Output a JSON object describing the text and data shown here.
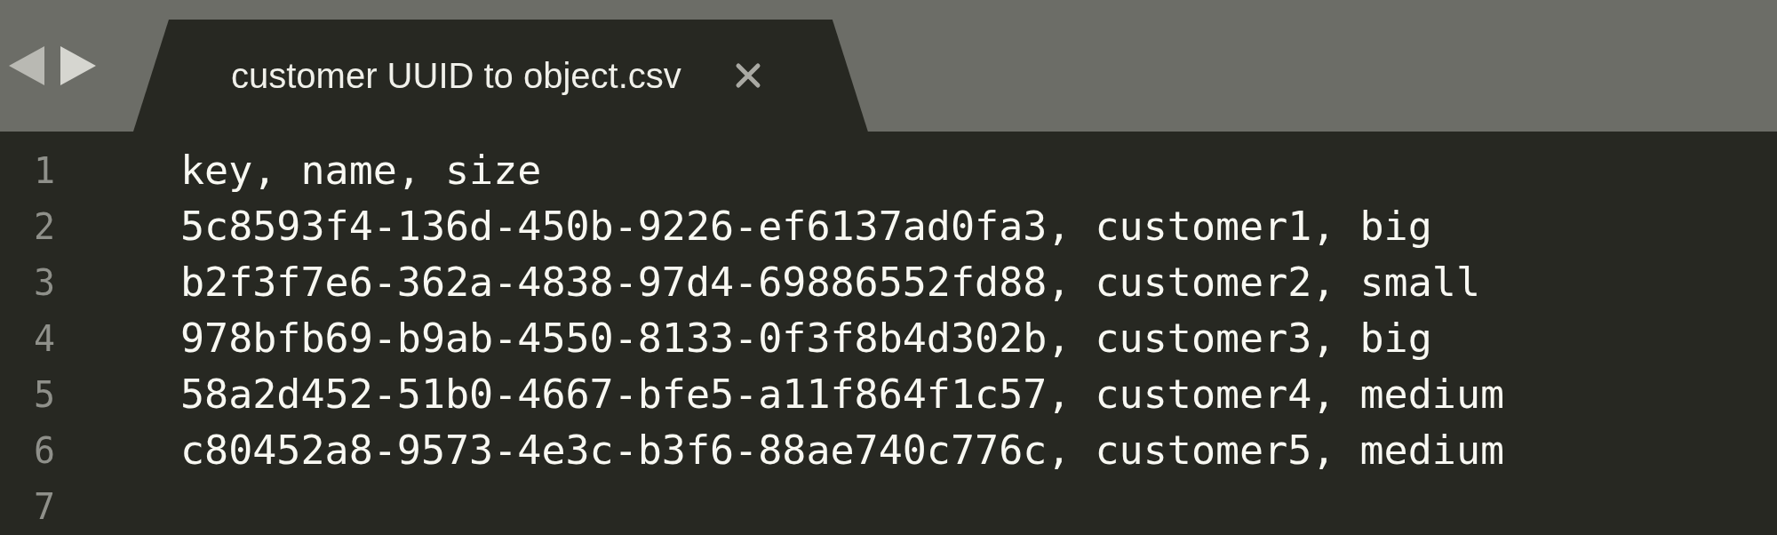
{
  "tabs": [
    {
      "title": "customer UUID to object.csv",
      "selected": true
    }
  ],
  "lines": [
    {
      "number": "1",
      "text": "key, name, size"
    },
    {
      "number": "2",
      "text": "5c8593f4-136d-450b-9226-ef6137ad0fa3, customer1, big"
    },
    {
      "number": "3",
      "text": "b2f3f7e6-362a-4838-97d4-69886552fd88, customer2, small"
    },
    {
      "number": "4",
      "text": "978bfb69-b9ab-4550-8133-0f3f8b4d302b, customer3, big"
    },
    {
      "number": "5",
      "text": "58a2d452-51b0-4667-bfe5-a11f864f1c57, customer4, medium"
    },
    {
      "number": "6",
      "text": "c80452a8-9573-4e3c-b3f6-88ae740c776c, customer5, medium"
    },
    {
      "number": "7"
    }
  ]
}
